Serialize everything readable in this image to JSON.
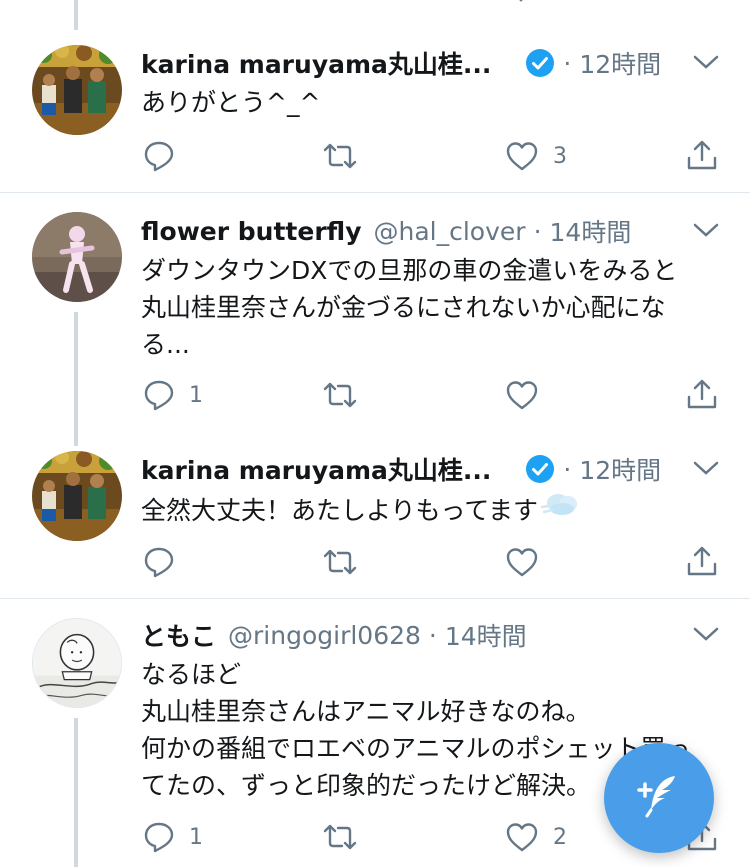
{
  "tweets": [
    {
      "name": "karina maruyama丸山桂...",
      "handle": "",
      "time": "12時間",
      "verified": true,
      "lines": [
        "ありがとう^_^"
      ],
      "reply_count": "",
      "like_count": "3"
    },
    {
      "name": "flower butterfly",
      "handle": "@hal_clover",
      "time": "14時間",
      "verified": false,
      "lines": [
        "ダウンタウンDXでの旦那の車の金遣いをみると",
        "丸山桂里奈さんが金づるにされないか心配にな",
        "る..."
      ],
      "reply_count": "1",
      "like_count": ""
    },
    {
      "name": "karina maruyama丸山桂...",
      "handle": "",
      "time": "12時間",
      "verified": true,
      "lines": [
        "全然大丈夫！あたしよりもってます"
      ],
      "emoji": "dash-cloud-emoji",
      "reply_count": "",
      "like_count": ""
    },
    {
      "name": "ともこ",
      "handle": "@ringogirl0628",
      "time": "14時間",
      "verified": false,
      "lines": [
        "なるほど",
        "丸山桂里奈さんはアニマル好きなのね。",
        "何かの番組でロエベのアニマルのポシェット買っ",
        "てたの、ずっと印象的だったけど解決。"
      ],
      "reply_count": "1",
      "like_count": "2"
    }
  ],
  "icons": {
    "reply": "reply-icon",
    "retweet": "retweet-icon",
    "like": "heart-icon",
    "share": "share-icon",
    "more": "chevron-down-icon",
    "verified": "verified-badge-icon",
    "compose": "compose-tweet-icon"
  },
  "colors": {
    "verified": "#1da1f2",
    "compose_fab": "#4a9ee9",
    "muted": "#657786",
    "thread_line": "#cfd9de"
  }
}
